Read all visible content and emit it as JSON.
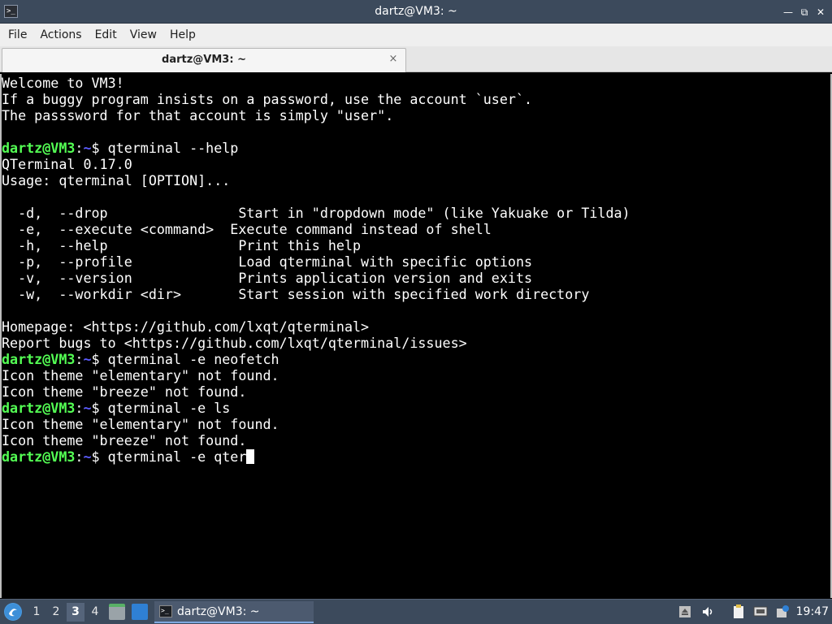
{
  "window": {
    "title": "dartz@VM3: ~",
    "icon_glyph": ">_",
    "controls": {
      "minimize": "—",
      "restore": "⧉",
      "close": "✕"
    }
  },
  "menubar": {
    "items": [
      "File",
      "Actions",
      "Edit",
      "View",
      "Help"
    ]
  },
  "tabs": [
    {
      "label": "dartz@VM3: ~",
      "close_glyph": "×"
    }
  ],
  "terminal": {
    "user_color": "#54ff54",
    "path_color": "#5c5cff",
    "lines": [
      {
        "text": "Welcome to VM3!"
      },
      {
        "text": "If a buggy program insists on a password, use the account `user`."
      },
      {
        "text": "The passsword for that account is simply \"user\"."
      },
      {
        "text": ""
      },
      {
        "prompt": {
          "user": "dartz@VM3",
          "sep": ":",
          "path": "~",
          "sigil": "$ "
        },
        "text": "qterminal --help"
      },
      {
        "text": "QTerminal 0.17.0"
      },
      {
        "text": "Usage: qterminal [OPTION]..."
      },
      {
        "text": ""
      },
      {
        "text": "  -d,  --drop                Start in \"dropdown mode\" (like Yakuake or Tilda)"
      },
      {
        "text": "  -e,  --execute <command>  Execute command instead of shell"
      },
      {
        "text": "  -h,  --help                Print this help"
      },
      {
        "text": "  -p,  --profile             Load qterminal with specific options"
      },
      {
        "text": "  -v,  --version             Prints application version and exits"
      },
      {
        "text": "  -w,  --workdir <dir>       Start session with specified work directory"
      },
      {
        "text": ""
      },
      {
        "text": "Homepage: <https://github.com/lxqt/qterminal>"
      },
      {
        "text": "Report bugs to <https://github.com/lxqt/qterminal/issues>"
      },
      {
        "prompt": {
          "user": "dartz@VM3",
          "sep": ":",
          "path": "~",
          "sigil": "$ "
        },
        "text": "qterminal -e neofetch"
      },
      {
        "text": "Icon theme \"elementary\" not found."
      },
      {
        "text": "Icon theme \"breeze\" not found."
      },
      {
        "prompt": {
          "user": "dartz@VM3",
          "sep": ":",
          "path": "~",
          "sigil": "$ "
        },
        "text": "qterminal -e ls"
      },
      {
        "text": "Icon theme \"elementary\" not found."
      },
      {
        "text": "Icon theme \"breeze\" not found."
      },
      {
        "prompt": {
          "user": "dartz@VM3",
          "sep": ":",
          "path": "~",
          "sigil": "$ "
        },
        "text": "qterminal -e qter",
        "cursor": true
      }
    ]
  },
  "taskbar": {
    "menu_icon": "lxqt-menu-icon",
    "workspaces": [
      {
        "label": "1",
        "active": false
      },
      {
        "label": "2",
        "active": false
      },
      {
        "label": "3",
        "active": true
      },
      {
        "label": "4",
        "active": false
      }
    ],
    "quicklaunch": [
      "file-manager-icon",
      "show-desktop-icon"
    ],
    "task": {
      "label": "dartz@VM3: ~",
      "icon": "terminal-icon"
    },
    "tray": [
      "eject-icon",
      "volume-icon",
      "clipboard-icon",
      "network-icon",
      "update-icon"
    ],
    "clock": "19:47"
  }
}
